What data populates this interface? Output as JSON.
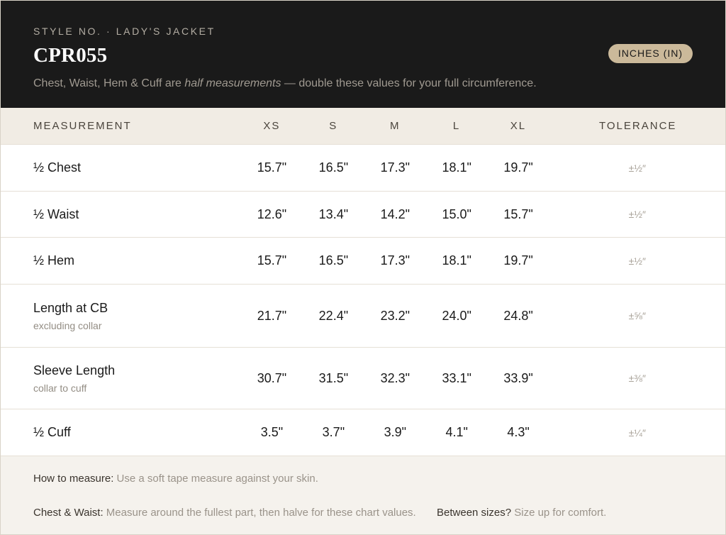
{
  "header": {
    "eyebrow": "STYLE NO. · LADY'S JACKET",
    "title": "CPR055",
    "subtitle_pre": "Chest, Waist, Hem & Cuff are ",
    "subtitle_em": "half measurements",
    "subtitle_post": " — double these values for your full circumference.",
    "unit_badge": "INCHES (IN)"
  },
  "columns": {
    "measurement": "MEASUREMENT",
    "sizes": [
      "XS",
      "S",
      "M",
      "L",
      "XL"
    ],
    "tolerance": "TOLERANCE"
  },
  "rows": [
    {
      "label": "½ Chest",
      "note": "",
      "values": [
        "15.7\"",
        "16.5\"",
        "17.3\"",
        "18.1\"",
        "19.7\""
      ],
      "tolerance": "±½″"
    },
    {
      "label": "½ Waist",
      "note": "",
      "values": [
        "12.6\"",
        "13.4\"",
        "14.2\"",
        "15.0\"",
        "15.7\""
      ],
      "tolerance": "±½″"
    },
    {
      "label": "½ Hem",
      "note": "",
      "values": [
        "15.7\"",
        "16.5\"",
        "17.3\"",
        "18.1\"",
        "19.7\""
      ],
      "tolerance": "±½″"
    },
    {
      "label": "Length at CB",
      "note": "excluding collar",
      "values": [
        "21.7\"",
        "22.4\"",
        "23.2\"",
        "24.0\"",
        "24.8\""
      ],
      "tolerance": "±⅝″"
    },
    {
      "label": "Sleeve Length",
      "note": "collar to cuff",
      "values": [
        "30.7\"",
        "31.5\"",
        "32.3\"",
        "33.1\"",
        "33.9\""
      ],
      "tolerance": "±⅜″"
    },
    {
      "label": "½ Cuff",
      "note": "",
      "values": [
        "3.5\"",
        "3.7\"",
        "3.9\"",
        "4.1\"",
        "4.3\""
      ],
      "tolerance": "±¼″"
    }
  ],
  "footer": {
    "how_label": "How to measure:",
    "how_text": " Use a soft tape measure against your skin.",
    "chest_label": "Chest & Waist:",
    "chest_text": " Measure around the fullest part, then halve for these chart values.",
    "between_label": "Between sizes?",
    "between_text": " Size up for comfort."
  }
}
